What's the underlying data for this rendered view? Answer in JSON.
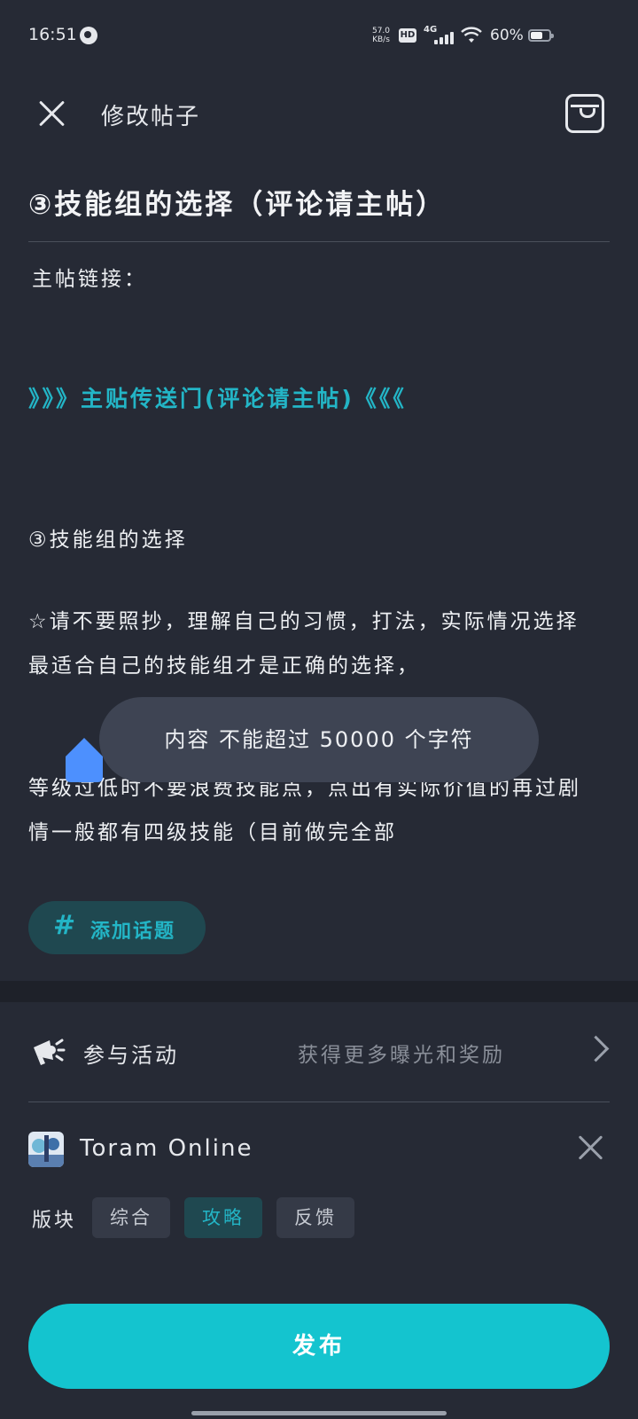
{
  "status_bar": {
    "time": "16:51",
    "net_speed_value": "57.0",
    "net_speed_unit": "KB/s",
    "hd": "HD",
    "network": "4G",
    "battery": "60%",
    "battery_level": 0.6
  },
  "header": {
    "title": "修改帖子",
    "close_icon": "close-icon",
    "right_icon": "draft-box-icon"
  },
  "post": {
    "title": "③技能组的选择（评论请主帖）",
    "body": {
      "line1": "主帖链接：",
      "link": "》》》主贴传送门(评论请主帖)《《《",
      "section": "③技能组的选择",
      "para1": "☆请不要照抄，理解自己的习惯，打法，实际情况选择最适合自己的技能组才是正确的选择，",
      "para2": "等级过低时不要浪费技能点，点出有实际价值的再过剧情一般都有四级技能（目前做完全部"
    }
  },
  "toast": {
    "message": "内容 不能超过 50000 个字符"
  },
  "topic_button": {
    "hash": "#",
    "label": "添加话题"
  },
  "activity": {
    "label": "参与活动",
    "hint": "获得更多曝光和奖励",
    "icon": "megaphone-icon"
  },
  "game": {
    "name": "Toram Online"
  },
  "forum": {
    "label": "版块",
    "options": [
      "综合",
      "攻略",
      "反馈"
    ],
    "selected": "攻略"
  },
  "publish": {
    "label": "发布"
  },
  "colors": {
    "accent": "#14c4cf",
    "link": "#23b5c6",
    "background": "#262a35"
  }
}
